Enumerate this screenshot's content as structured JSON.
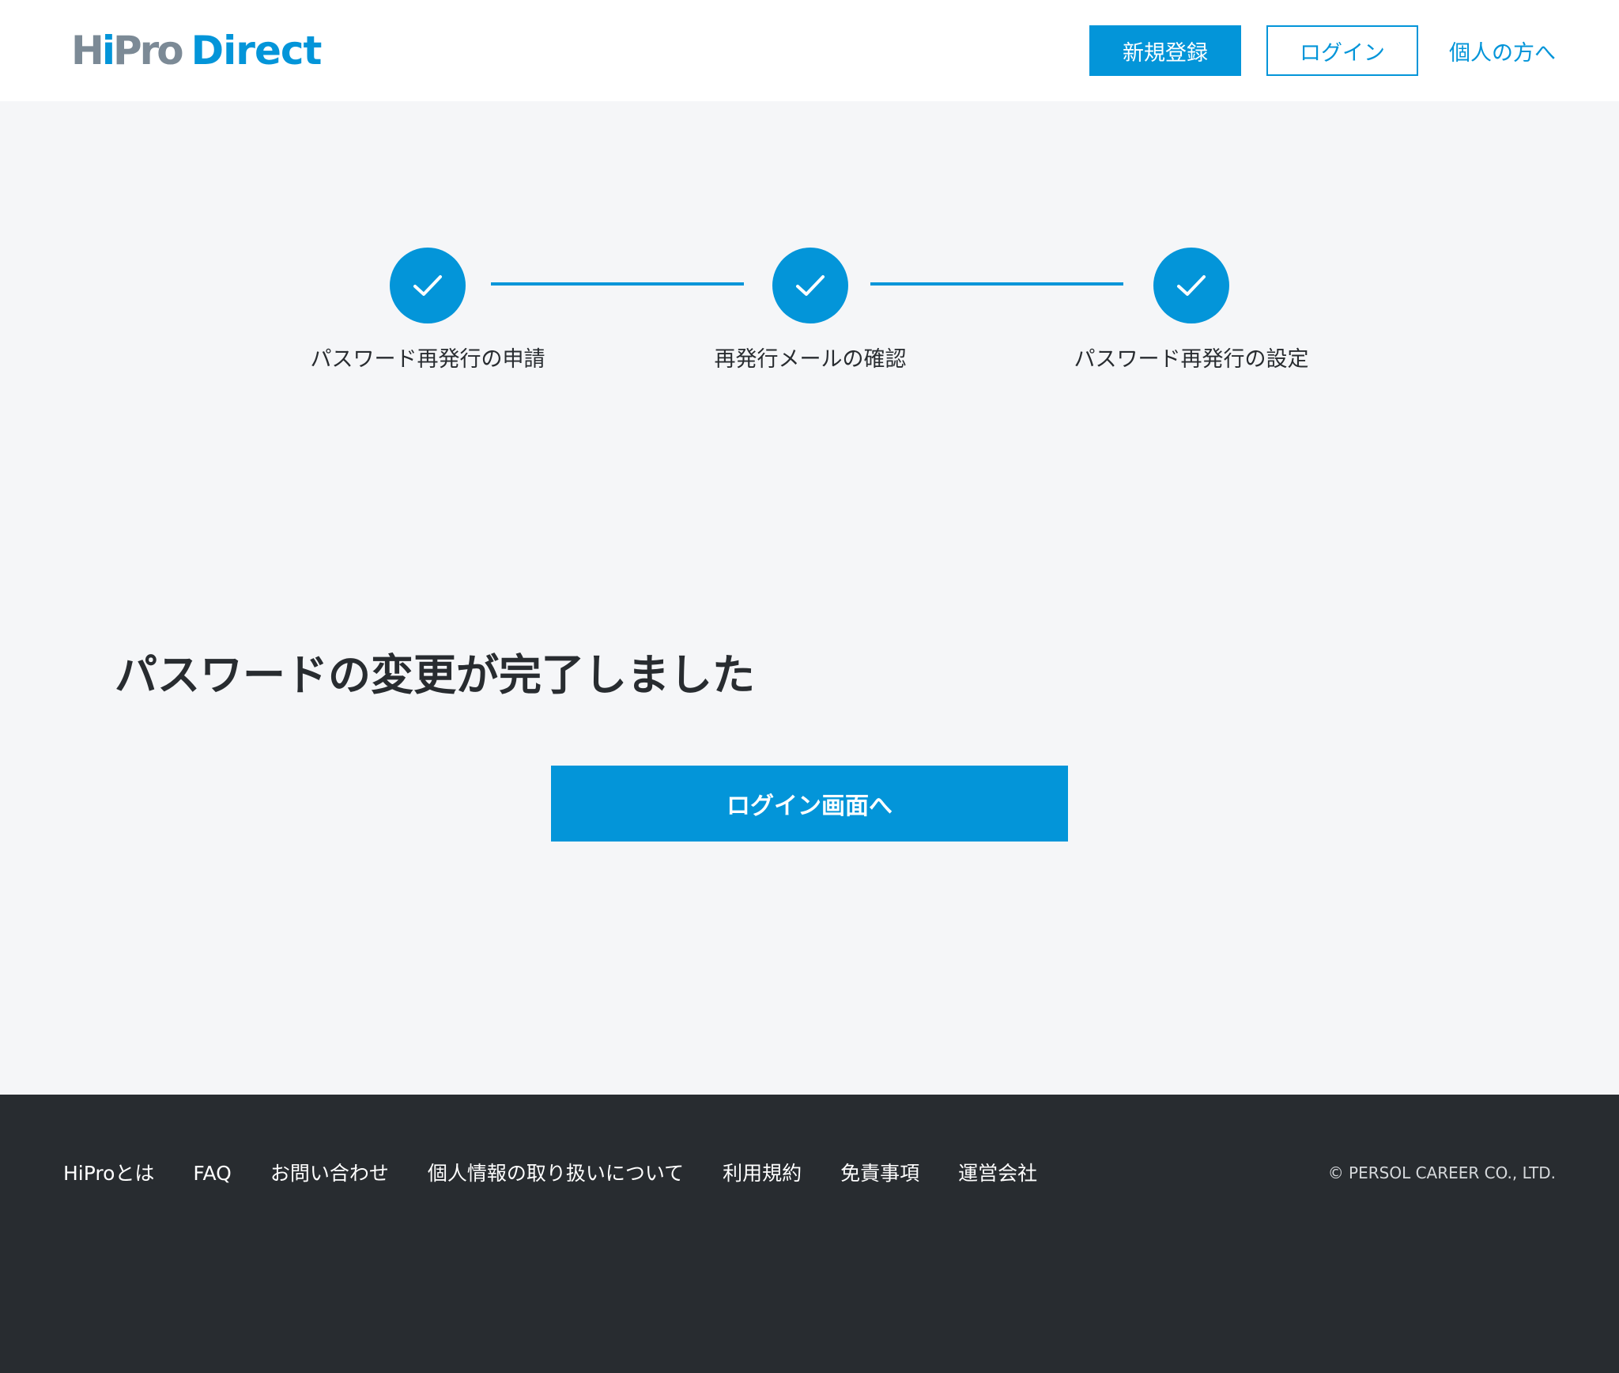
{
  "header": {
    "logo_hipro_h": "H",
    "logo_hipro_i": "i",
    "logo_hipro_rest": "Pro",
    "logo_direct": "Direct",
    "register_label": "新規登録",
    "login_label": "ログイン",
    "individual_label": "個人の方へ"
  },
  "steps": [
    {
      "label": "パスワード再発行の申請",
      "status": "done"
    },
    {
      "label": "再発行メールの確認",
      "status": "done"
    },
    {
      "label": "パスワード再発行の設定",
      "status": "done"
    }
  ],
  "main": {
    "title": "パスワードの変更が完了しました",
    "login_button_label": "ログイン画面へ"
  },
  "footer": {
    "links": [
      "HiProとは",
      "FAQ",
      "お問い合わせ",
      "個人情報の取り扱いについて",
      "利用規約",
      "免責事項",
      "運営会社"
    ],
    "copyright": "© PERSOL CAREER CO., LTD."
  },
  "colors": {
    "accent": "#0395d9",
    "background": "#f5f6f8",
    "footer": "#282c30",
    "text": "#282c30"
  }
}
